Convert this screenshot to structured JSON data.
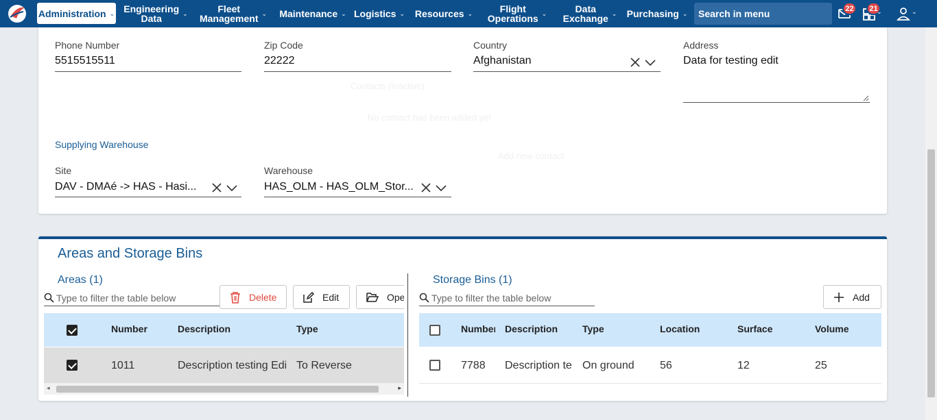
{
  "nav": {
    "items": [
      {
        "label": "Administration",
        "active": true
      },
      {
        "label": "Engineering\nData"
      },
      {
        "label": "Fleet\nManagement"
      },
      {
        "label": "Maintenance"
      },
      {
        "label": "Logistics"
      },
      {
        "label": "Resources"
      },
      {
        "label": "Flight\nOperations"
      },
      {
        "label": "Data\nExchange"
      },
      {
        "label": "Purchasing"
      }
    ],
    "search_placeholder": "Search in menu",
    "mail_badge": "22",
    "apps_badge": "21"
  },
  "contact": {
    "phone_label": "Phone Number",
    "phone_value": "5515515511",
    "zip_label": "Zip Code",
    "zip_value": "22222",
    "country_label": "Country",
    "country_value": "Afghanistan",
    "address_label": "Address",
    "address_value": "Data for testing edit",
    "ghost_text_1": "Contacts (inactive)",
    "ghost_text_2": "No contact has been added yet",
    "ghost_text_3": "Add new contact"
  },
  "supplying": {
    "section_title": "Supplying Warehouse",
    "site_label": "Site",
    "site_value": "DAV - DMAé -> HAS - Hasi...",
    "warehouse_label": "Warehouse",
    "warehouse_value": "HAS_OLM - HAS_OLM_Stor..."
  },
  "areas_section": {
    "title": "Areas and Storage Bins",
    "areas": {
      "title": "Areas (1)",
      "filter_placeholder": "Type to filter the table below",
      "buttons": {
        "delete": "Delete",
        "edit": "Edit",
        "open": "Open"
      },
      "columns": [
        "Number",
        "Description",
        "Type"
      ],
      "rows": [
        {
          "number": "1011",
          "description": "Description testing Edit",
          "type": "To Reverse",
          "checked": true
        }
      ]
    },
    "bins": {
      "title": "Storage Bins (1)",
      "filter_placeholder": "Type to filter the table below",
      "add_label": "Add",
      "columns": [
        "Number",
        "Description",
        "Type",
        "Location",
        "Surface",
        "Volume"
      ],
      "rows": [
        {
          "number": "7788",
          "description": "Description test",
          "type": "On ground",
          "location": "56",
          "surface": "12",
          "volume": "25",
          "checked": false
        }
      ]
    }
  },
  "colors": {
    "nav_bg": "#0d4f8b",
    "accent": "#1a5d96",
    "table_header": "#cfe7fb",
    "delete": "#e0473b",
    "badge": "#e04848"
  }
}
